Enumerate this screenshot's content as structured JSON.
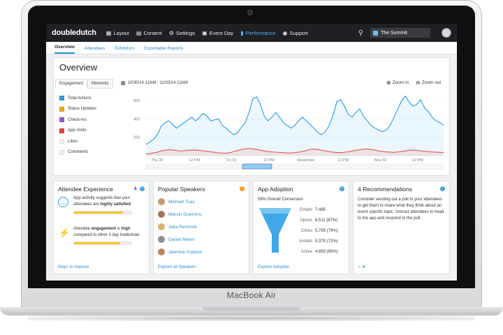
{
  "device": {
    "brand": "MacBook Air"
  },
  "nav": {
    "logo": "doubledutch",
    "items": [
      {
        "label": "Layout",
        "icon": "layout-icon"
      },
      {
        "label": "Content",
        "icon": "book-icon"
      },
      {
        "label": "Settings",
        "icon": "gear-icon"
      },
      {
        "label": "Event Day",
        "icon": "calendar-icon"
      },
      {
        "label": "Performance",
        "icon": "bar-chart-icon",
        "active": true
      },
      {
        "label": "Support",
        "icon": "lifebuoy-icon"
      }
    ],
    "event_name": "The Summit"
  },
  "subnav": {
    "tabs": [
      {
        "label": "Overview",
        "active": true
      },
      {
        "label": "Attendees"
      },
      {
        "label": "Exhibitors"
      },
      {
        "label": "Exportable Reports"
      }
    ]
  },
  "overview": {
    "title": "Overview",
    "tabs": [
      "Engagement",
      "Moments"
    ],
    "date_range": "10/30/14 12AM  -  11/03/14 12AM",
    "zoom_in": "Zoom in",
    "zoom_out": "Zoom out",
    "legend": [
      {
        "label": "Total Actions",
        "color": "#2f9be0"
      },
      {
        "label": "Status Updates",
        "color": "#f5a623"
      },
      {
        "label": "Check-ins",
        "color": "#8e5cc9"
      },
      {
        "label": "App Visits",
        "color": "#e0463a"
      },
      {
        "label": "Likes",
        "color": "#f0f0f0"
      },
      {
        "label": "Comments",
        "color": "#f0f0f0"
      }
    ]
  },
  "chart_data": {
    "type": "line",
    "x_tick_labels": [
      "Thu 30",
      "12 PM",
      "Fri 31",
      "12 PM",
      "November",
      "12 PM",
      "Nov 02",
      "12 PM"
    ],
    "y_ticks": [
      200,
      400,
      600
    ],
    "ylim": [
      0,
      700
    ],
    "series": [
      {
        "name": "Total Actions",
        "color": "#2f9be0",
        "values": [
          120,
          150,
          180,
          230,
          320,
          360,
          380,
          340,
          300,
          330,
          360,
          390,
          420,
          380,
          420,
          460,
          430,
          380,
          390,
          400,
          330,
          300,
          260,
          230,
          250,
          310,
          360,
          470,
          620,
          640,
          560,
          430,
          380,
          420,
          470,
          420,
          360,
          330,
          300,
          330,
          380,
          420,
          380,
          340,
          300,
          250,
          230,
          260,
          330,
          440,
          590,
          610,
          540,
          450,
          420,
          470,
          510,
          430,
          380,
          330,
          300,
          280,
          260,
          280,
          330,
          420,
          510,
          600,
          650,
          580,
          540,
          560,
          610,
          520,
          480,
          420,
          380,
          360,
          330
        ]
      },
      {
        "name": "App Visits",
        "color": "#e0463a",
        "values": [
          20,
          22,
          30,
          38,
          52,
          60,
          64,
          62,
          56,
          52,
          54,
          58,
          62,
          60,
          58,
          52,
          48,
          42,
          36,
          30,
          28,
          26,
          32,
          44,
          56,
          66,
          74,
          78,
          74,
          66,
          58,
          50,
          44,
          40,
          38,
          34,
          32,
          30,
          28,
          32,
          38,
          46,
          56,
          66,
          72,
          68,
          60,
          52,
          44,
          38,
          34,
          32,
          36,
          42,
          50,
          58,
          64,
          70,
          72,
          66,
          60,
          52,
          46,
          40,
          38,
          36,
          40,
          46,
          52,
          58,
          60,
          56,
          52,
          48,
          44,
          40,
          38,
          36,
          34
        ]
      }
    ]
  },
  "attendee_experience": {
    "title": "Attendee Experience",
    "text1a": "App activity suggests that your",
    "text1b": "attendees are",
    "text1c": "highly satisfied",
    "text2a": "Attendee",
    "text2b": "engagement",
    "text2c": "is",
    "text2d": "high",
    "text2e": "compared to other 3 day tradeshow",
    "meter1": 0.85,
    "meter2": 0.8,
    "link": "Ways to improve"
  },
  "popular_speakers": {
    "title": "Popular Speakers",
    "speakers": [
      "Michael Tsao",
      "Marvin Guerrero",
      "Julia Remnick",
      "Daniel Milani",
      "Jasmine Krylova"
    ],
    "link": "Explore all Speakers"
  },
  "app_adoption": {
    "title": "App Adoption",
    "conversion": "58% Overall Conversion",
    "rows": [
      {
        "label": "Emails",
        "value": "7,485"
      },
      {
        "label": "Opens",
        "value": "6,511 (87%)"
      },
      {
        "label": "Clicks",
        "value": "5,795 (79%)"
      },
      {
        "label": "Installs",
        "value": "5,378 (72%)"
      },
      {
        "label": "Active",
        "value": "4,893 (65%)"
      }
    ],
    "link": "Explore Adoption"
  },
  "recommendations": {
    "title": "4 Recommendations",
    "text": "Consider sending out a poll to your attendees to get them to share what they think about an event specific topic. Instruct attendees to head to the app and respond to the poll."
  }
}
